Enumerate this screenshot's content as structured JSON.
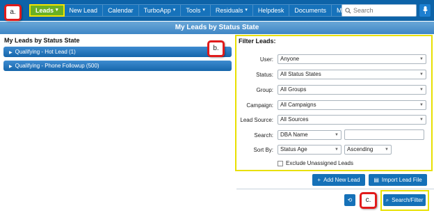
{
  "nav": {
    "items": [
      {
        "label": "Leads",
        "caret": "▾"
      },
      {
        "label": "New Lead",
        "caret": ""
      },
      {
        "label": "Calendar",
        "caret": ""
      },
      {
        "label": "TurboApp",
        "caret": "▾"
      },
      {
        "label": "Tools",
        "caret": "▾"
      },
      {
        "label": "Residuals",
        "caret": "▾"
      },
      {
        "label": "Helpdesk",
        "caret": ""
      },
      {
        "label": "Documents",
        "caret": ""
      },
      {
        "label": "Manage",
        "caret": "▾"
      }
    ],
    "search_placeholder": "Search"
  },
  "page_title": "My Leads by Status State",
  "left": {
    "heading": "My Leads by Status State",
    "status_rows": [
      "Qualifying - Hot Lead (1)",
      "Qualifying - Phone Followup (500)"
    ]
  },
  "filter": {
    "title": "Filter Leads:",
    "user_label": "User:",
    "user_value": "Anyone",
    "status_label": "Status:",
    "status_value": "All Status States",
    "group_label": "Group:",
    "group_value": "All Groups",
    "campaign_label": "Campaign:",
    "campaign_value": "All Campaigns",
    "source_label": "Lead Source:",
    "source_value": "All Sources",
    "search_label": "Search:",
    "search_field_value": "DBA Name",
    "sort_label": "Sort By:",
    "sort_value": "Status Age",
    "sort_order_value": "Ascending",
    "exclude_label": "Exclude Unassigned Leads"
  },
  "buttons": {
    "add_new_lead": "Add New Lead",
    "import_lead_file": "Import Lead File",
    "search_filter": "Search/Filter"
  },
  "callouts": {
    "a": "a.",
    "b": "b.",
    "c": "c."
  },
  "colors": {
    "nav_bg": "#0d63a8",
    "active_tab": "#6ab023",
    "highlight": "#e8e000",
    "callout_border": "#e11b1b",
    "button": "#1571b8"
  }
}
